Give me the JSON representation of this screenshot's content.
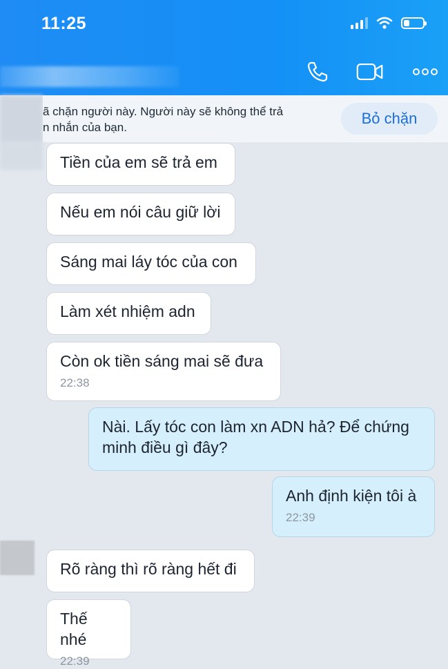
{
  "status_bar": {
    "time": "11:25"
  },
  "banner": {
    "text": "ã chặn người này. Người này sẽ không thể trả\nn nhắn của bạn.",
    "unblock_label": "Bỏ chặn"
  },
  "messages": [
    {
      "text": "Tiền của em sẽ trả em",
      "time": ""
    },
    {
      "text": "Nếu em nói câu giữ lời",
      "time": ""
    },
    {
      "text": "Sáng mai láy tóc của con",
      "time": ""
    },
    {
      "text": "Làm xét nhiệm adn",
      "time": ""
    },
    {
      "text": "Còn ok tiền sáng mai sẽ đưa",
      "time": "22:38"
    },
    {
      "text": "Nài. Lấy tóc con làm xn ADN hả? Để chứng minh điều gì đây?",
      "time": ""
    },
    {
      "text": "Anh định kiện tôi à",
      "time": "22:39"
    },
    {
      "text": "Rõ ràng thì rõ ràng hết đi",
      "time": ""
    },
    {
      "text": "Thế nhé",
      "time": "22:39"
    }
  ],
  "colors": {
    "header": "#1e8cf4",
    "incoming_bubble": "#ffffff",
    "outgoing_bubble": "#d6effc",
    "background": "#e3e8ef"
  }
}
